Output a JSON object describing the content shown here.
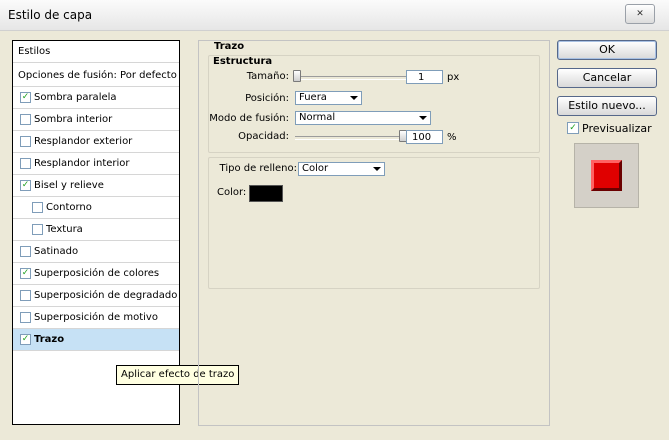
{
  "window": {
    "title": "Estilo de capa",
    "close_symbol": "✕"
  },
  "styles_panel": {
    "header": "Estilos",
    "blending_options": "Opciones de fusión: Por defecto",
    "items": [
      {
        "label": "Sombra paralela",
        "checked": true,
        "indent": 0
      },
      {
        "label": "Sombra interior",
        "checked": false,
        "indent": 0
      },
      {
        "label": "Resplandor exterior",
        "checked": false,
        "indent": 0
      },
      {
        "label": "Resplandor interior",
        "checked": false,
        "indent": 0
      },
      {
        "label": "Bisel y relieve",
        "checked": true,
        "indent": 0
      },
      {
        "label": "Contorno",
        "checked": false,
        "indent": 1
      },
      {
        "label": "Textura",
        "checked": false,
        "indent": 1
      },
      {
        "label": "Satinado",
        "checked": false,
        "indent": 0
      },
      {
        "label": "Superposición de colores",
        "checked": true,
        "indent": 0
      },
      {
        "label": "Superposición de degradado",
        "checked": false,
        "indent": 0
      },
      {
        "label": "Superposición de motivo",
        "checked": false,
        "indent": 0
      },
      {
        "label": "Trazo",
        "checked": true,
        "indent": 0,
        "selected": true
      }
    ],
    "tooltip": "Aplicar efecto de trazo"
  },
  "stroke": {
    "title": "Trazo",
    "structure": {
      "legend": "Estructura",
      "size_label": "Tamaño:",
      "size_value": "1",
      "size_unit": "px",
      "size_level": 0,
      "position_label": "Posición:",
      "position_value": "Fuera",
      "blend_label": "Modo de fusión:",
      "blend_value": "Normal",
      "opacity_label": "Opacidad:",
      "opacity_value": "100",
      "opacity_unit": "%",
      "opacity_level": 1.0
    },
    "fill": {
      "type_label": "Tipo de relleno:",
      "type_value": "Color",
      "color_label": "Color:",
      "color_value": "#000000"
    }
  },
  "buttons": {
    "ok": "OK",
    "cancel": "Cancelar",
    "new_style": "Estilo nuevo...",
    "preview_label": "Previsualizar",
    "preview_checked": true
  },
  "colors": {
    "preview_swatch": "#e00000",
    "selected_row": "#c6e1f5",
    "check": "#21a121"
  }
}
